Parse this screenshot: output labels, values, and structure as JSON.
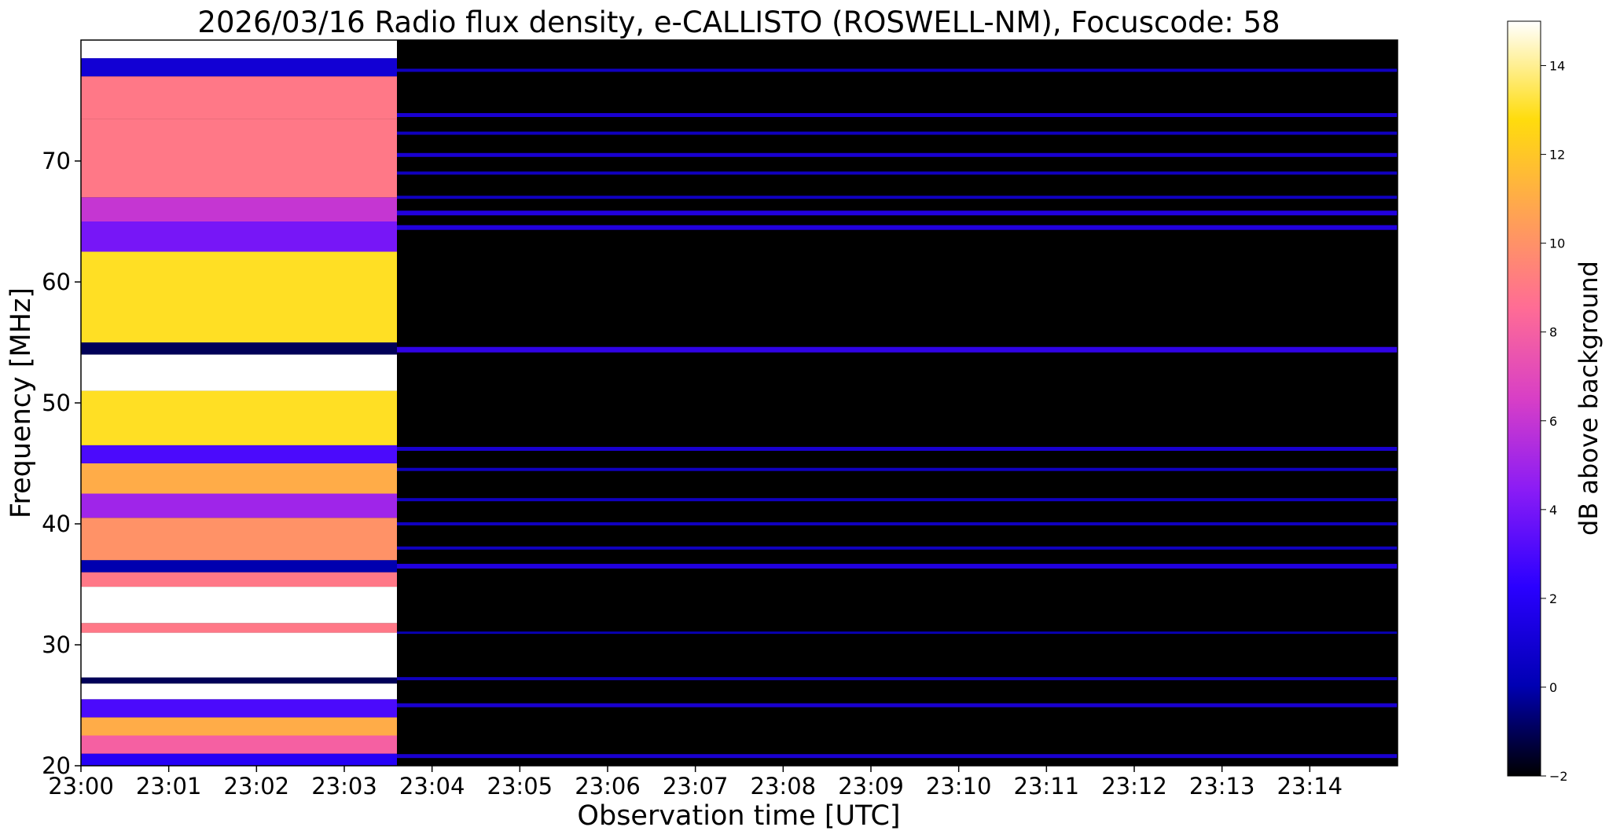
{
  "chart_data": {
    "type": "heatmap",
    "title": "2026/03/16  Radio flux density, e-CALLISTO (ROSWELL-NM), Focuscode: 58",
    "xlabel": "Observation time [UTC]",
    "ylabel": "Frequency [MHz]",
    "x_ticks": [
      "23:00",
      "23:01",
      "23:02",
      "23:03",
      "23:04",
      "23:05",
      "23:06",
      "23:07",
      "23:08",
      "23:09",
      "23:10",
      "23:11",
      "23:12",
      "23:13",
      "23:14"
    ],
    "y_ticks": [
      20,
      30,
      40,
      50,
      60,
      70
    ],
    "xlim": [
      "23:00:00",
      "23:15:00"
    ],
    "ylim": [
      20,
      80
    ],
    "colormap": "gnuplot2",
    "colorbar": {
      "label": "dB above background",
      "ticks": [
        -2,
        0,
        2,
        4,
        6,
        8,
        10,
        12,
        14
      ],
      "range": [
        -2,
        15
      ]
    },
    "segments": [
      {
        "time_start": "23:00:00",
        "time_end": "23:03:36",
        "typical_level_db": 11
      },
      {
        "time_start": "23:03:36",
        "time_end": "23:15:00",
        "typical_level_db": -2
      }
    ],
    "bright_band_db": {
      "segment1": [
        {
          "freq_mhz": [
            20.0,
            21.0
          ],
          "db": 2
        },
        {
          "freq_mhz": [
            21.0,
            22.5
          ],
          "db": 8
        },
        {
          "freq_mhz": [
            22.5,
            24.0
          ],
          "db": 11
        },
        {
          "freq_mhz": [
            24.0,
            25.5
          ],
          "db": 3
        },
        {
          "freq_mhz": [
            25.5,
            26.8
          ],
          "db": 15
        },
        {
          "freq_mhz": [
            26.8,
            27.3
          ],
          "db": -1
        },
        {
          "freq_mhz": [
            27.3,
            31.0
          ],
          "db": 15
        },
        {
          "freq_mhz": [
            31.0,
            31.8
          ],
          "db": 9
        },
        {
          "freq_mhz": [
            31.8,
            34.8
          ],
          "db": 15
        },
        {
          "freq_mhz": [
            34.8,
            36.0
          ],
          "db": 9
        },
        {
          "freq_mhz": [
            36.0,
            37.0
          ],
          "db": 0
        },
        {
          "freq_mhz": [
            37.0,
            40.5
          ],
          "db": 10
        },
        {
          "freq_mhz": [
            40.5,
            42.5
          ],
          "db": 5
        },
        {
          "freq_mhz": [
            42.5,
            45.0
          ],
          "db": 11
        },
        {
          "freq_mhz": [
            45.0,
            46.5
          ],
          "db": 3
        },
        {
          "freq_mhz": [
            46.5,
            51.0
          ],
          "db": 13
        },
        {
          "freq_mhz": [
            51.0,
            54.0
          ],
          "db": 15
        },
        {
          "freq_mhz": [
            54.0,
            55.0
          ],
          "db": -1
        },
        {
          "freq_mhz": [
            55.0,
            62.5
          ],
          "db": 13
        },
        {
          "freq_mhz": [
            62.5,
            65.0
          ],
          "db": 4
        },
        {
          "freq_mhz": [
            65.0,
            67.0
          ],
          "db": 6
        },
        {
          "freq_mhz": [
            67.0,
            73.5
          ],
          "db": 9
        },
        {
          "freq_mhz": [
            73.5,
            77.0
          ],
          "db": 9
        },
        {
          "freq_mhz": [
            77.0,
            78.5
          ],
          "db": 1
        },
        {
          "freq_mhz": [
            78.5,
            80.0
          ],
          "db": 15
        }
      ],
      "segment2_bands": [
        {
          "freq_mhz": 20.8,
          "db": 1.5
        },
        {
          "freq_mhz": 25.0,
          "db": 1.5
        },
        {
          "freq_mhz": 27.2,
          "db": 1.0
        },
        {
          "freq_mhz": 31.0,
          "db": 0.5
        },
        {
          "freq_mhz": 36.5,
          "db": 2.0
        },
        {
          "freq_mhz": 38.0,
          "db": 1.0
        },
        {
          "freq_mhz": 40.0,
          "db": 1.0
        },
        {
          "freq_mhz": 42.0,
          "db": 1.0
        },
        {
          "freq_mhz": 44.5,
          "db": 1.0
        },
        {
          "freq_mhz": 46.2,
          "db": 1.5
        },
        {
          "freq_mhz": 54.4,
          "db": 2.5
        },
        {
          "freq_mhz": 64.5,
          "db": 2.0
        },
        {
          "freq_mhz": 65.7,
          "db": 2.0
        },
        {
          "freq_mhz": 67.0,
          "db": 1.0
        },
        {
          "freq_mhz": 69.0,
          "db": 1.0
        },
        {
          "freq_mhz": 70.5,
          "db": 1.5
        },
        {
          "freq_mhz": 72.3,
          "db": 1.0
        },
        {
          "freq_mhz": 73.8,
          "db": 1.5
        },
        {
          "freq_mhz": 77.5,
          "db": 1.0
        }
      ]
    }
  }
}
